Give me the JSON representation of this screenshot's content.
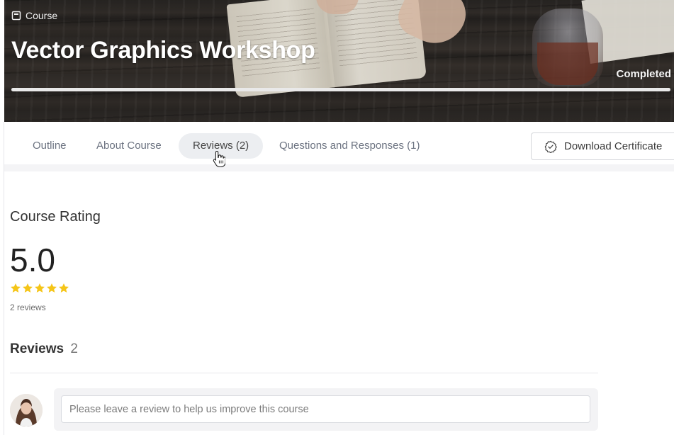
{
  "hero": {
    "label": "Course",
    "title": "Vector Graphics Workshop",
    "status": "Completed",
    "progress_fraction": 1.0
  },
  "tabs": [
    {
      "label": "Outline",
      "active": false
    },
    {
      "label": "About Course",
      "active": false
    },
    {
      "label": "Reviews (2)",
      "active": true
    },
    {
      "label": "Questions and Responses (1)",
      "active": false
    }
  ],
  "certificate_button": {
    "label": "Download Certificate",
    "icon": "badge-check-icon"
  },
  "rating": {
    "title": "Course Rating",
    "value": "5.0",
    "stars": 5,
    "count_label": "2 reviews",
    "star_color": "#f5c518"
  },
  "reviews": {
    "heading": "Reviews",
    "count": "2",
    "input_placeholder": "Please leave a review to help us improve this course"
  }
}
